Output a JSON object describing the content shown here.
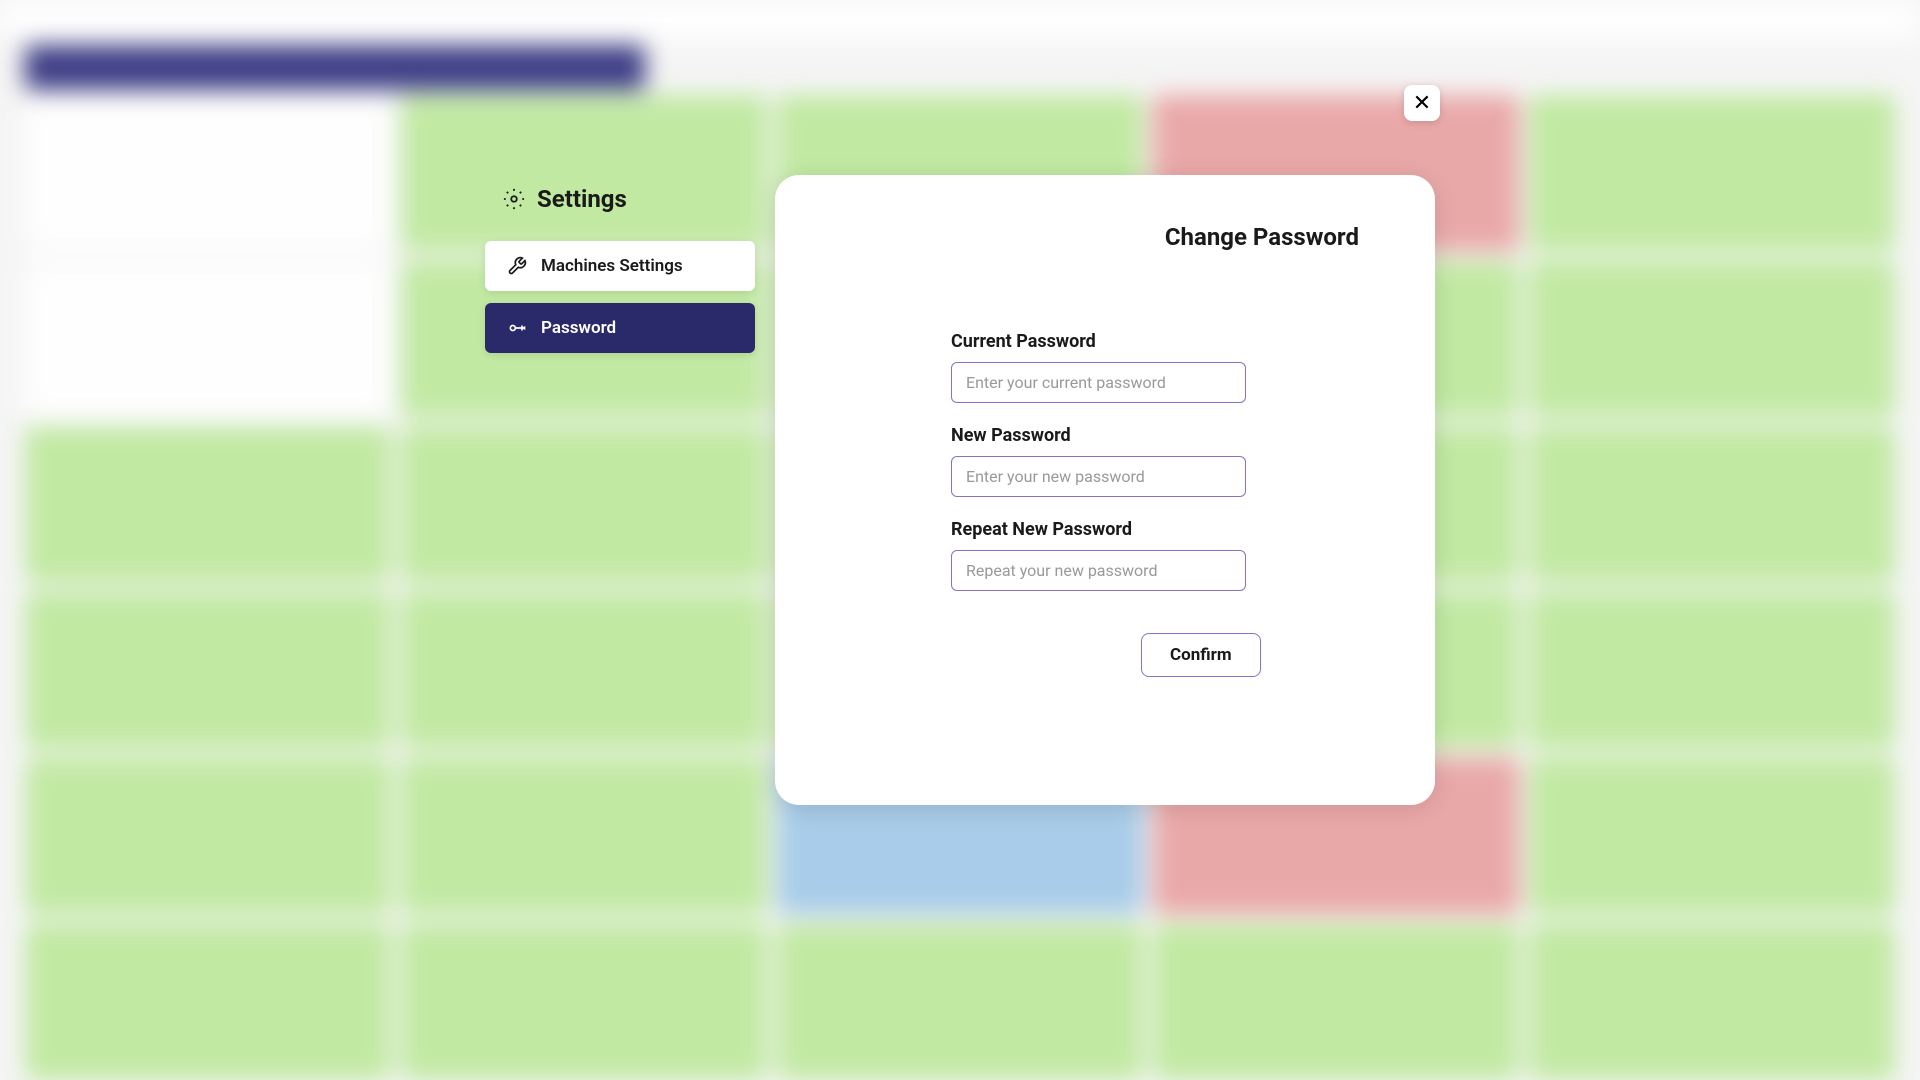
{
  "sidebar": {
    "title": "Settings",
    "items": [
      {
        "label": "Machines Settings",
        "active": false
      },
      {
        "label": "Password",
        "active": true
      }
    ]
  },
  "panel": {
    "title": "Change Password",
    "fields": {
      "current": {
        "label": "Current Password",
        "placeholder": "Enter your current password"
      },
      "new": {
        "label": "New Password",
        "placeholder": "Enter your new password"
      },
      "repeat": {
        "label": "Repeat New Password",
        "placeholder": "Repeat your new password"
      }
    },
    "confirm_label": "Confirm"
  },
  "close_label": "✕"
}
